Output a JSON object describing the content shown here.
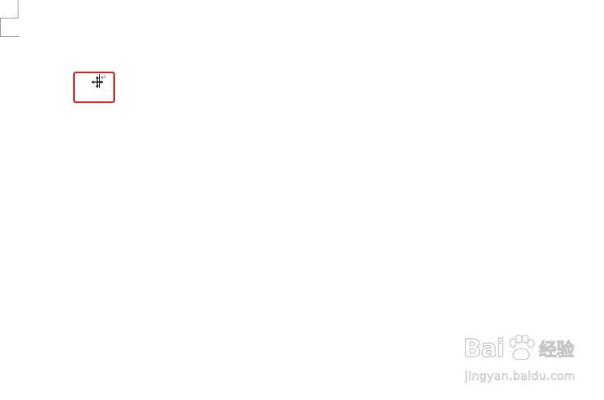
{
  "document": {
    "paragraph_mark": "↵"
  },
  "highlight": {
    "color": "#e0201c"
  },
  "watermark": {
    "brand": "Bai",
    "brand_suffix": "经验",
    "url": "jingyan.baidu.com",
    "icon": "paw-icon"
  }
}
